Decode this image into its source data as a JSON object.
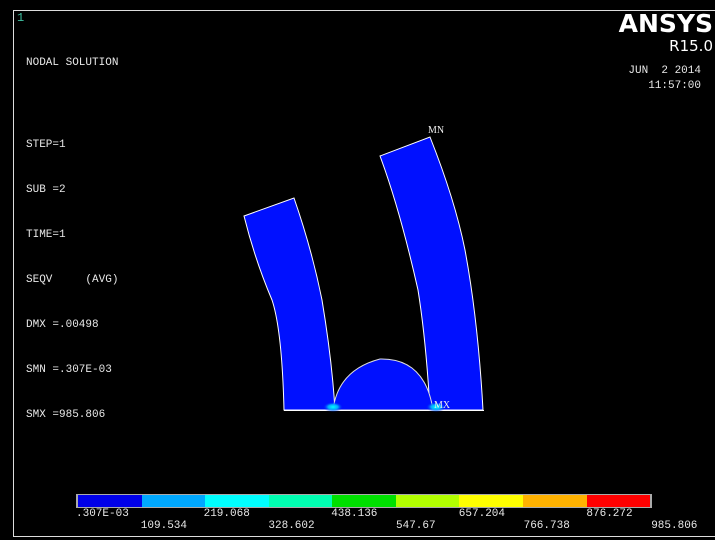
{
  "window_number": "1",
  "info": {
    "title": "NODAL SOLUTION",
    "lines": [
      "STEP=1",
      "SUB =2",
      "TIME=1",
      "SEQV     (AVG)",
      "DMX =.00498",
      "SMN =.307E-03",
      "SMX =985.806"
    ]
  },
  "header": {
    "brand": "ANSYS",
    "release": "R15.0",
    "date": "JUN  2 2014",
    "time": "11:57:00"
  },
  "markers": {
    "min": "MN",
    "max": "MX"
  },
  "legend": {
    "colors": [
      "#0000e8",
      "#00a8ff",
      "#00ffff",
      "#00ffb2",
      "#00e000",
      "#b2ff00",
      "#ffff00",
      "#ffb200",
      "#ff0000"
    ],
    "labels_top": [
      ".307E-03",
      "219.068",
      "438.136",
      "657.204",
      "876.272"
    ],
    "labels_bottom": [
      "109.534",
      "328.602",
      "547.67",
      "766.738",
      "985.806"
    ]
  },
  "colors": {
    "model_fill": "#0010ff",
    "edge": "#ffffff",
    "background": "#000000"
  }
}
